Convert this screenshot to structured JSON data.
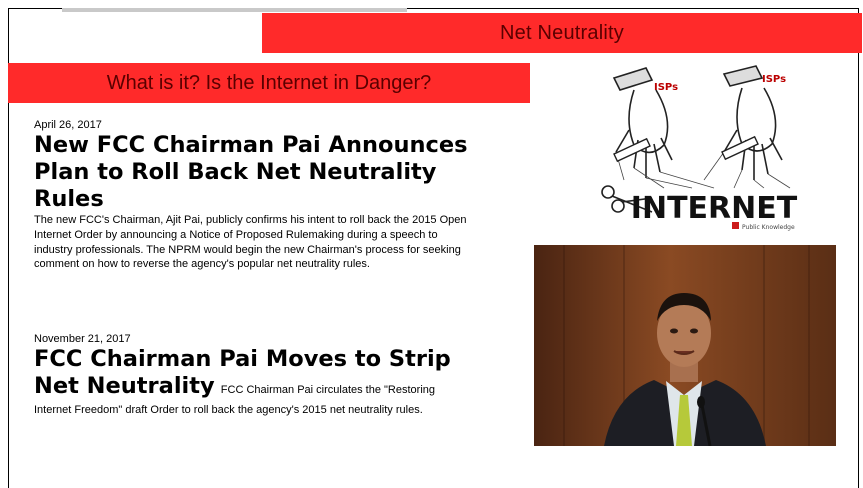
{
  "banner": {
    "title": "Net Neutrality",
    "subtitle": "What is it? Is the Internet in Danger?"
  },
  "articles": [
    {
      "date": "April 26, 2017",
      "headline": "New FCC Chairman Pai Announces Plan to Roll Back Net Neutrality Rules",
      "body": "The new FCC's Chairman, Ajit Pai, publicly confirms his intent to roll back the 2015 Open Internet Order by announcing a Notice of Proposed Rulemaking during a speech to industry professionals. The NPRM would begin the new Chairman's process for seeking comment on how to reverse the agency's popular net neutrality rules."
    },
    {
      "date": "November 21, 2017",
      "headline": "FCC Chairman Pai Moves to Strip Net Neutrality",
      "body": "FCC Chairman Pai circulates the \"Restoring Internet Freedom\" draft Order to roll back the agency's 2015 net neutrality rules."
    }
  ],
  "cartoon": {
    "isp_label_left": "ISPs",
    "isp_label_right": "ISPs",
    "word": "INTERNET",
    "credit": "Public Knowledge"
  },
  "colors": {
    "banner": "#ff2a2a",
    "banner_text": "#5a0000"
  }
}
